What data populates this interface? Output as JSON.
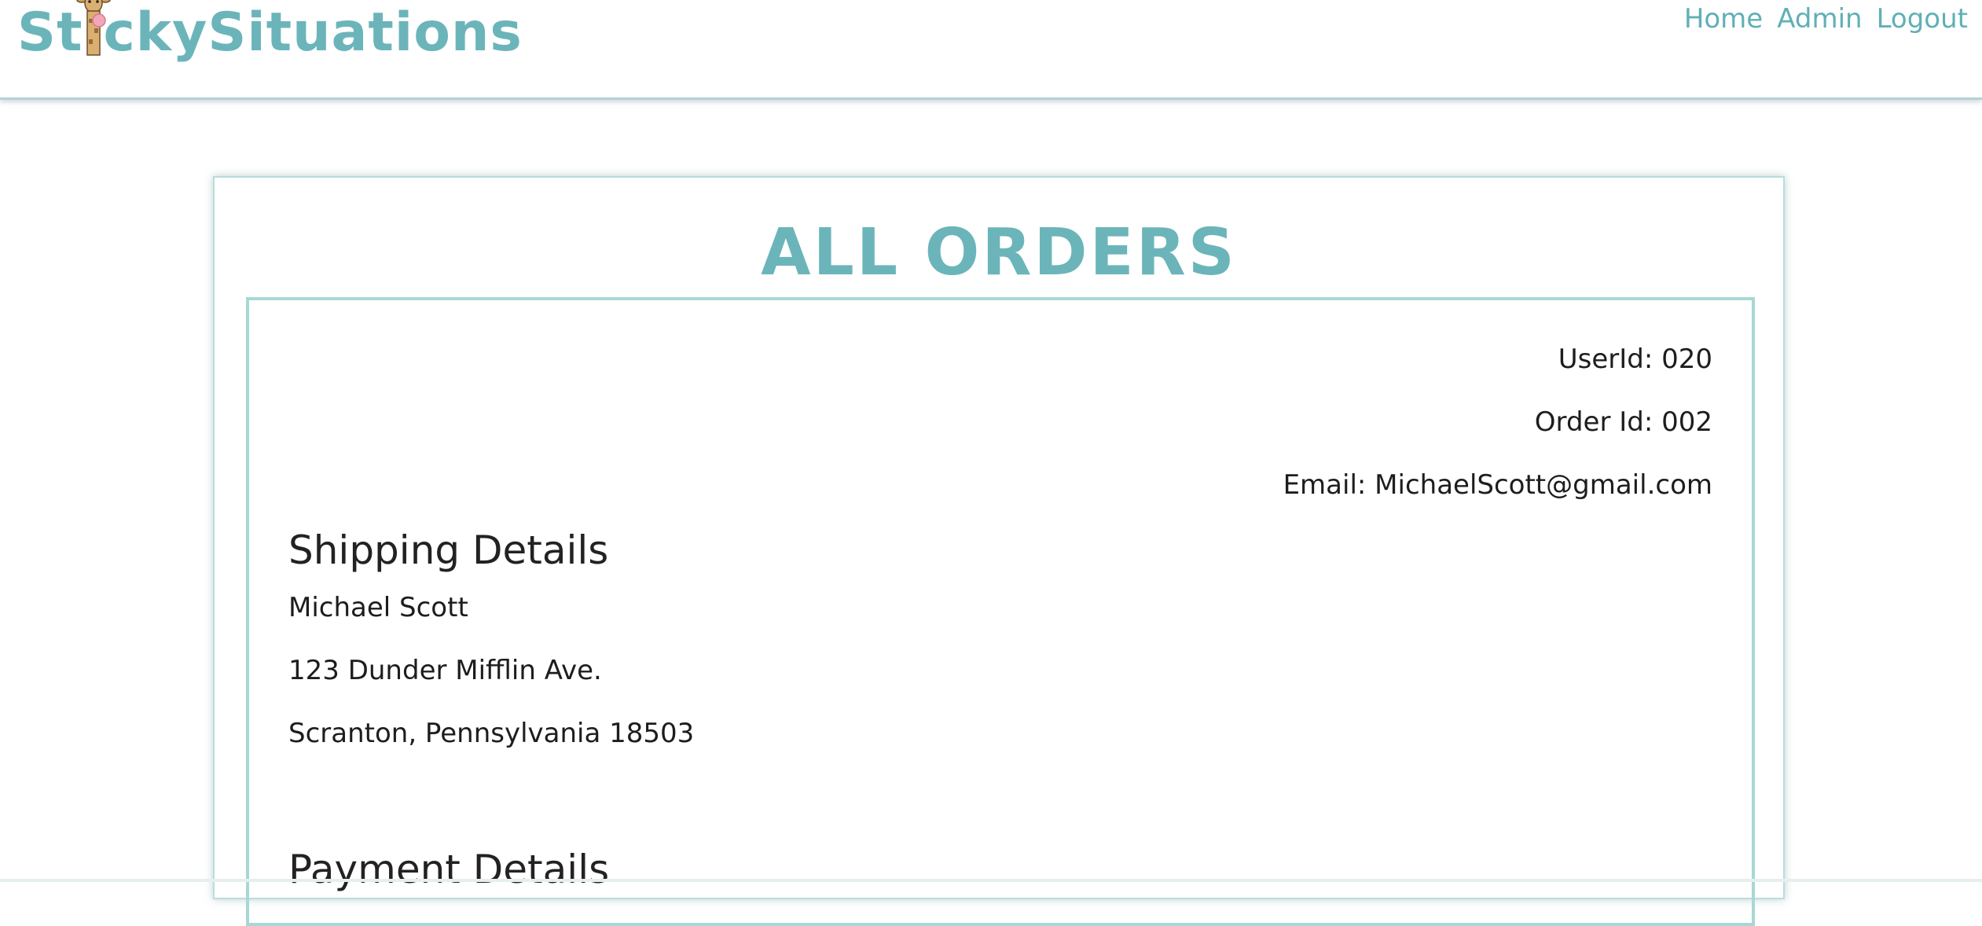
{
  "header": {
    "logo_prefix": "St",
    "logo_suffix": "ckySituations",
    "nav": {
      "home": "Home",
      "admin": "Admin",
      "logout": "Logout"
    }
  },
  "page": {
    "title": "ALL ORDERS"
  },
  "order": {
    "user_id": "UserId: 020",
    "order_id": "Order Id: 002",
    "email": "Email: MichaelScott@gmail.com",
    "shipping_title": "Shipping Details",
    "shipping_name": "Michael Scott",
    "shipping_street": "123 Dunder Mifflin Ave.",
    "shipping_city": "Scranton, Pennsylvania 18503",
    "payment_title": "Payment Details"
  },
  "colors": {
    "accent": "#6bb5ba",
    "nav_link": "#5fb0b6",
    "order_border": "#a7d8d6"
  }
}
